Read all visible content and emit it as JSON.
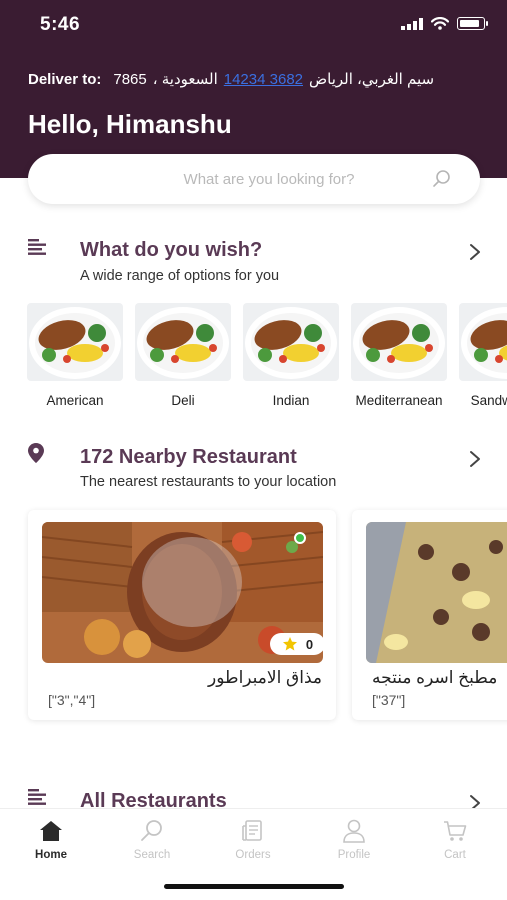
{
  "status_bar": {
    "time": "5:46",
    "battery_level": 0.85,
    "icons": [
      "signal-icon",
      "wifi-icon",
      "battery-icon"
    ]
  },
  "header": {
    "deliver_label": "Deliver to:",
    "deliver_number": "7865",
    "deliver_address_city": "السعودية ،",
    "deliver_address_link": "14234 3682",
    "deliver_address_street": "سيم الغربي، الرياض",
    "greeting": "Hello, Himanshu"
  },
  "search": {
    "placeholder": "What are you looking for?"
  },
  "wish_section": {
    "title": "What do you wish?",
    "subtitle": "A wide range of options for you",
    "categories": [
      {
        "label": "American"
      },
      {
        "label": "Deli"
      },
      {
        "label": "Indian"
      },
      {
        "label": "Mediterranean"
      },
      {
        "label": "Sandwiches"
      }
    ]
  },
  "nearby_section": {
    "title": "172 Nearby Restaurant",
    "subtitle": "The nearest restaurants to your location",
    "restaurants": [
      {
        "name": "مذاق الامبراطور",
        "tags": "[\"3\",\"4\"]",
        "rating": "0",
        "open": true
      },
      {
        "name": "مطبخ اسره منتجه",
        "tags": "[\"37\"]",
        "rating": "",
        "open": false
      }
    ]
  },
  "all_section": {
    "title": "All Restaurants"
  },
  "bottom_nav": {
    "items": [
      {
        "label": "Home",
        "icon": "home-icon",
        "active": true
      },
      {
        "label": "Search",
        "icon": "search-icon",
        "active": false
      },
      {
        "label": "Orders",
        "icon": "orders-icon",
        "active": false
      },
      {
        "label": "Profile",
        "icon": "profile-icon",
        "active": false
      },
      {
        "label": "Cart",
        "icon": "cart-icon",
        "active": false
      }
    ]
  },
  "colors": {
    "header_bg": "#3a1c32",
    "section_title": "#5a3a55",
    "link": "#3b6fe0",
    "open_indicator": "#3fbf4a",
    "star": "#f2c400"
  }
}
